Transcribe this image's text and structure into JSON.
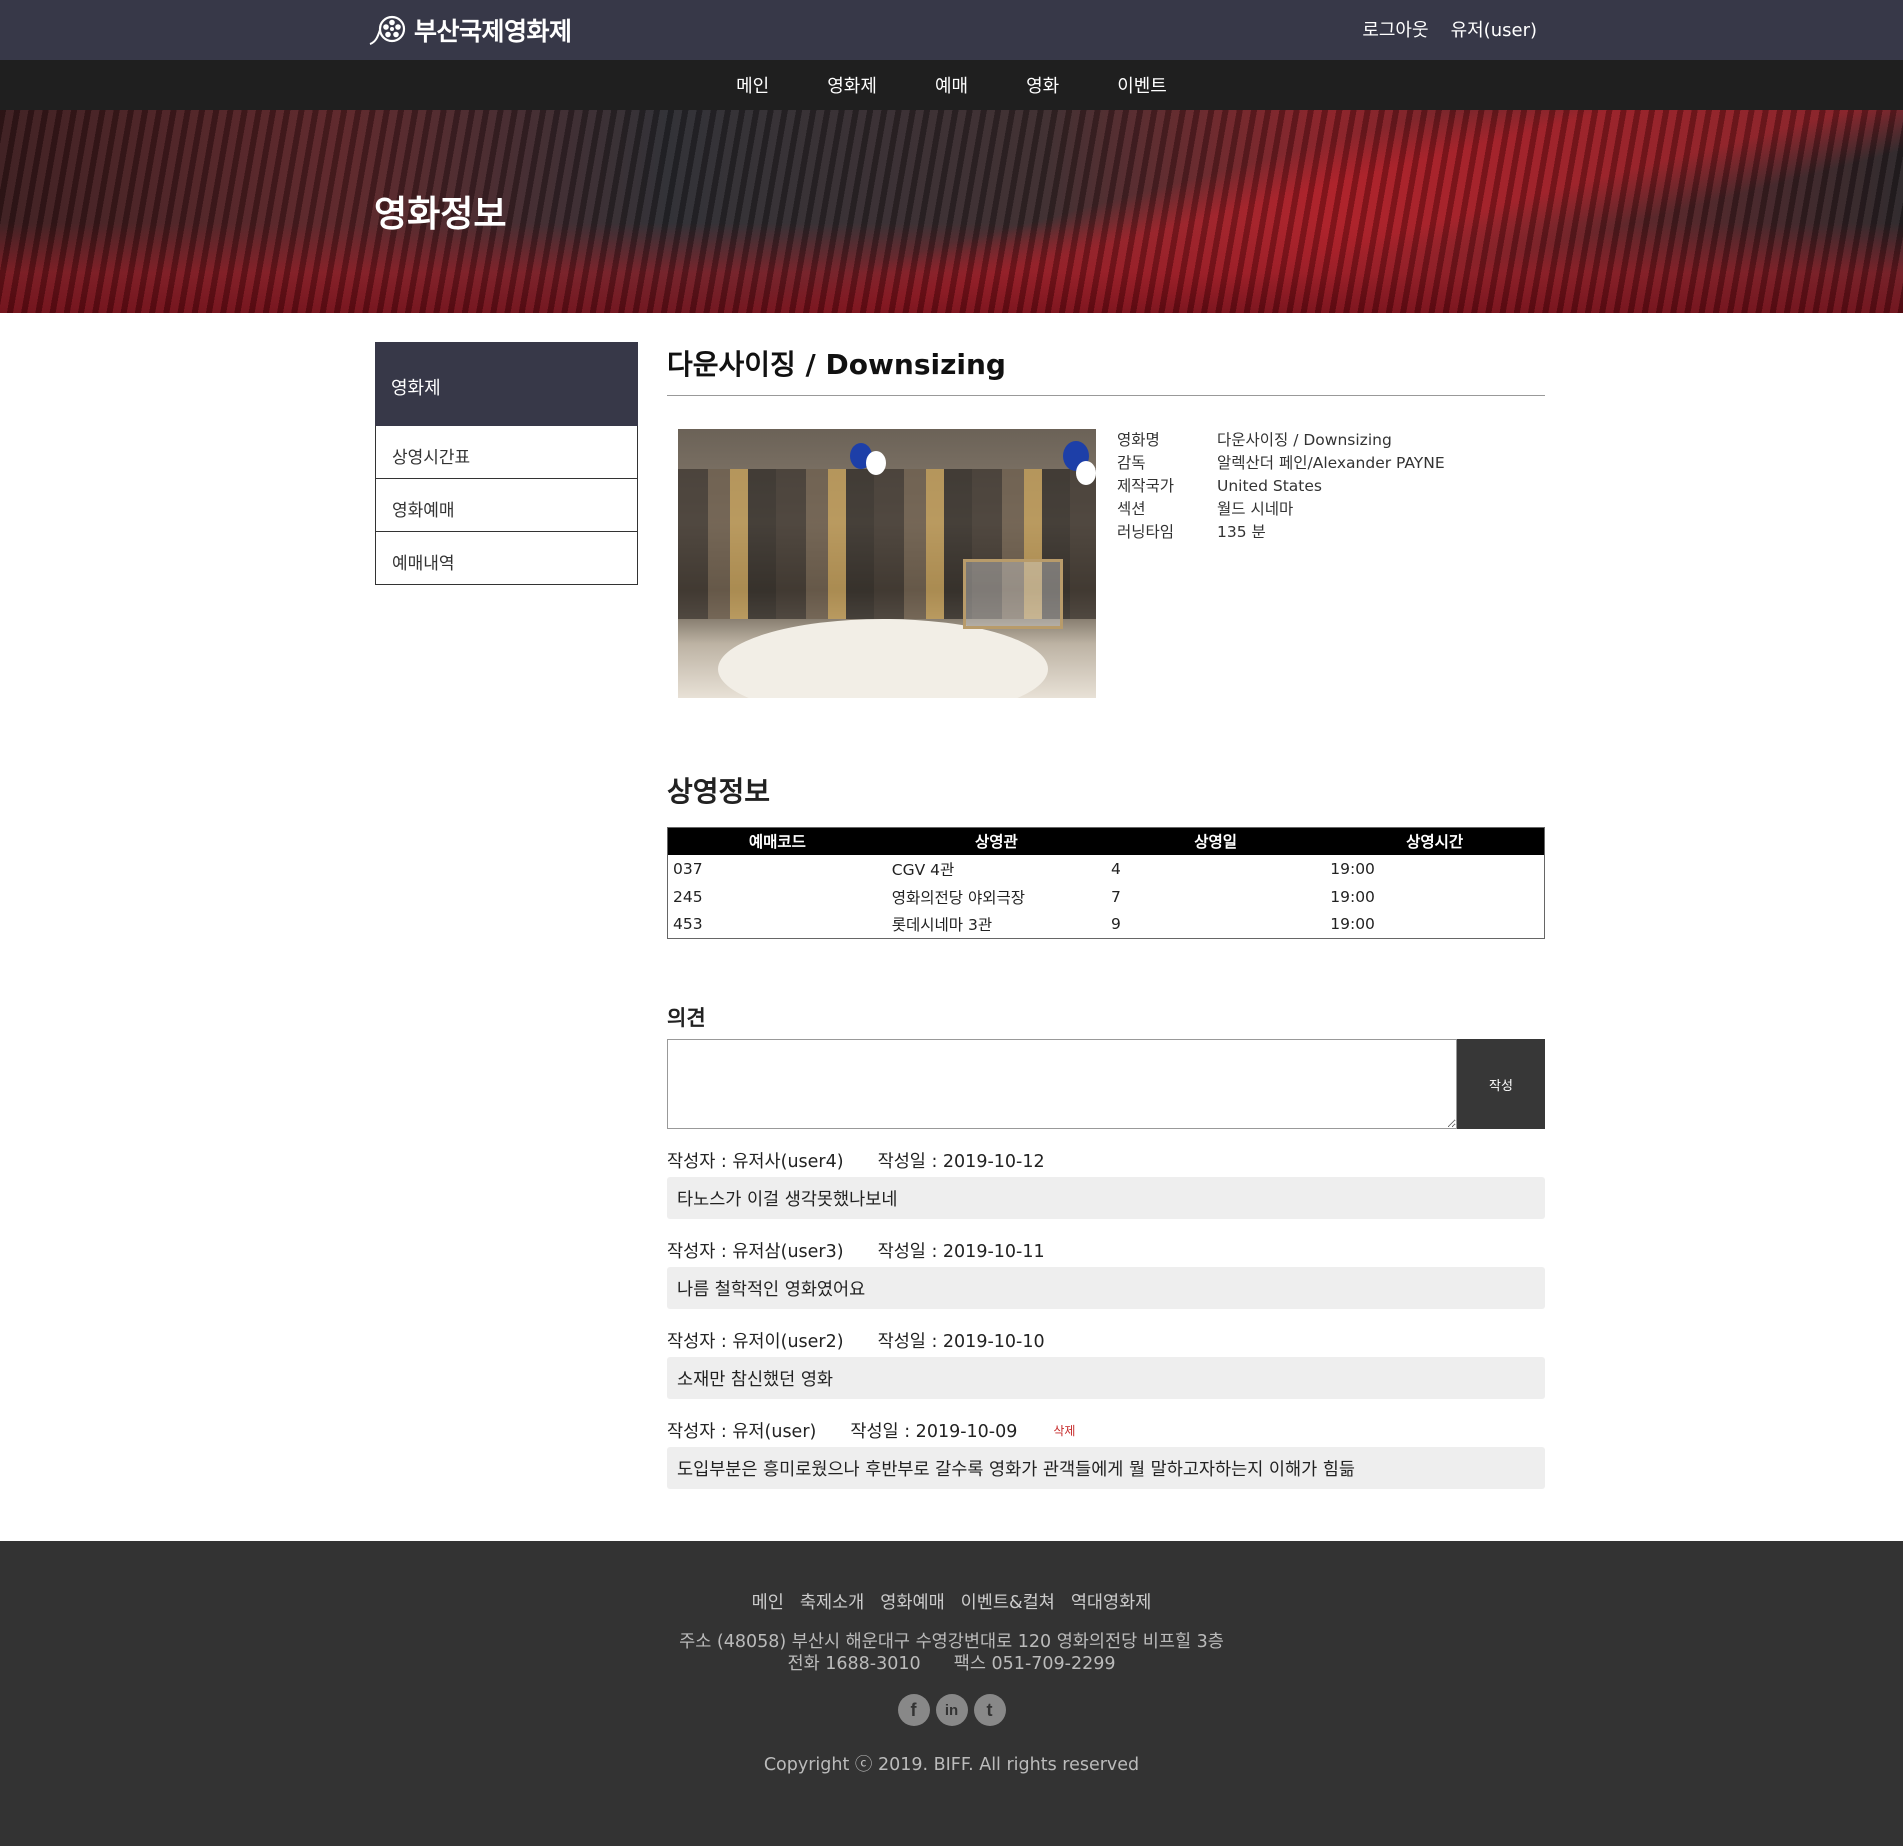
{
  "header": {
    "logo_text": "부산국제영화제",
    "logout_label": "로그아웃",
    "user_label": "유저(user)"
  },
  "nav": {
    "items": [
      "메인",
      "영화제",
      "예매",
      "영화",
      "이벤트"
    ]
  },
  "banner": {
    "title": "영화정보"
  },
  "sidebar": {
    "heading": "영화제",
    "items": [
      "상영시간표",
      "영화예매",
      "예매내역"
    ]
  },
  "movie": {
    "title_ko": "다운사이징",
    "title_sep": " / ",
    "title_en": "Downsizing",
    "info": [
      {
        "key": "영화명",
        "value": "다운사이징 / Downsizing"
      },
      {
        "key": "감독",
        "value": "알렉산더 페인/Alexander PAYNE"
      },
      {
        "key": "제작국가",
        "value": "United States"
      },
      {
        "key": "섹션",
        "value": "월드 시네마"
      },
      {
        "key": "러닝타임",
        "value": "135 분"
      }
    ]
  },
  "schedule": {
    "title": "상영정보",
    "columns": [
      "예매코드",
      "상영관",
      "상영일",
      "상영시간"
    ],
    "rows": [
      [
        "037",
        "CGV 4관",
        "4",
        "19:00"
      ],
      [
        "245",
        "영화의전당 야외극장",
        "7",
        "19:00"
      ],
      [
        "453",
        "롯데시네마 3관",
        "9",
        "19:00"
      ]
    ]
  },
  "opinion": {
    "title": "의견",
    "submit_label": "작성",
    "textarea_value": ""
  },
  "comments": [
    {
      "author": "작성자 : 유저사(user4)",
      "date": "작성일 : 2019-10-12",
      "body": "타노스가 이걸 생각못했나보네",
      "delete": ""
    },
    {
      "author": "작성자 : 유저삼(user3)",
      "date": "작성일 : 2019-10-11",
      "body": "나름 철학적인 영화였어요",
      "delete": ""
    },
    {
      "author": "작성자 : 유저이(user2)",
      "date": "작성일 : 2019-10-10",
      "body": "소재만 참신했던 영화",
      "delete": ""
    },
    {
      "author": "작성자 : 유저(user)",
      "date": "작성일 : 2019-10-09",
      "body": "도입부분은 흥미로웠으나 후반부로 갈수록 영화가 관객들에게 뭘 말하고자하는지 이해가 힘듦",
      "delete": "삭제"
    }
  ],
  "footer": {
    "links": [
      "메인",
      "축제소개",
      "영화예매",
      "이벤트&컬쳐",
      "역대영화제"
    ],
    "address": "주소 (48058) 부산시 해운대구 수영강변대로 120 영화의전당 비프힐 3층",
    "phone": "전화 1688-3010",
    "fax": "팩스 051-709-2299",
    "social": [
      {
        "icon": "facebook-icon",
        "glyph": "f"
      },
      {
        "icon": "linkedin-icon",
        "glyph": "in"
      },
      {
        "icon": "twitter-icon",
        "glyph": "t"
      }
    ],
    "copyright": "Copyright ⓒ 2019. BIFF. All rights reserved"
  },
  "colors": {
    "topbar": "#373848",
    "navbar": "#1f1f1f",
    "footer": "#333333",
    "delete": "#c62828"
  }
}
